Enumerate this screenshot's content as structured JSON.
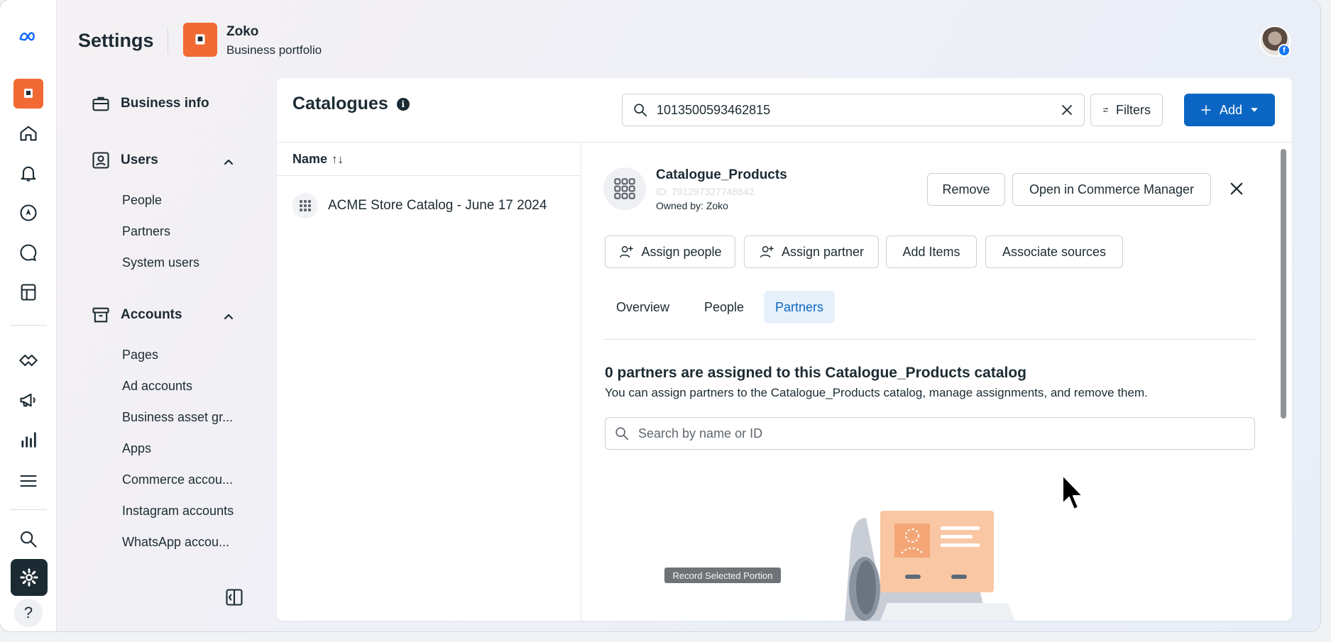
{
  "header": {
    "title": "Settings",
    "business_name": "Zoko",
    "business_subtitle": "Business portfolio"
  },
  "rail": {
    "icons": [
      "meta-logo-icon",
      "business-icon",
      "home-icon",
      "bell-icon",
      "compass-icon",
      "chat-icon",
      "pages-icon",
      "handshake-icon",
      "megaphone-icon",
      "bar-chart-icon",
      "menu-icon",
      "search-icon",
      "gear-icon",
      "help-icon"
    ],
    "help_label": "?"
  },
  "nav": {
    "business_info": "Business info",
    "users": {
      "label": "Users",
      "items": [
        "People",
        "Partners",
        "System users"
      ]
    },
    "accounts": {
      "label": "Accounts",
      "items": [
        "Pages",
        "Ad accounts",
        "Business asset gr...",
        "Apps",
        "Commerce accou...",
        "Instagram accounts",
        "WhatsApp accou..."
      ]
    }
  },
  "catalogues": {
    "title": "Catalogues",
    "search_value": "1013500593462815",
    "filters_label": "Filters",
    "add_label": "Add",
    "list_header": "Name",
    "sort_glyph": "↑↓",
    "rows": [
      "ACME Store Catalog - June 17 2024"
    ]
  },
  "detail": {
    "name": "Catalogue_Products",
    "id": "ID: 791297327748642",
    "owner": "Owned by: Zoko",
    "remove_label": "Remove",
    "open_label": "Open in Commerce Manager",
    "actions": {
      "assign_people": "Assign people",
      "assign_partner": "Assign partner",
      "add_items": "Add Items",
      "associate_sources": "Associate sources"
    },
    "tabs": [
      "Overview",
      "People",
      "Partners"
    ],
    "active_tab": "Partners",
    "partners_heading": "0 partners are assigned to this Catalogue_Products catalog",
    "partners_desc": "You can assign partners to the Catalogue_Products catalog, manage assignments, and remove them.",
    "partners_search_placeholder": "Search by name or ID"
  },
  "overlay": {
    "record_label": "Record Selected Portion"
  },
  "colors": {
    "brand_orange": "#f26a33",
    "primary_blue": "#0a66c2",
    "active_tab_bg": "#e7f1fb"
  }
}
